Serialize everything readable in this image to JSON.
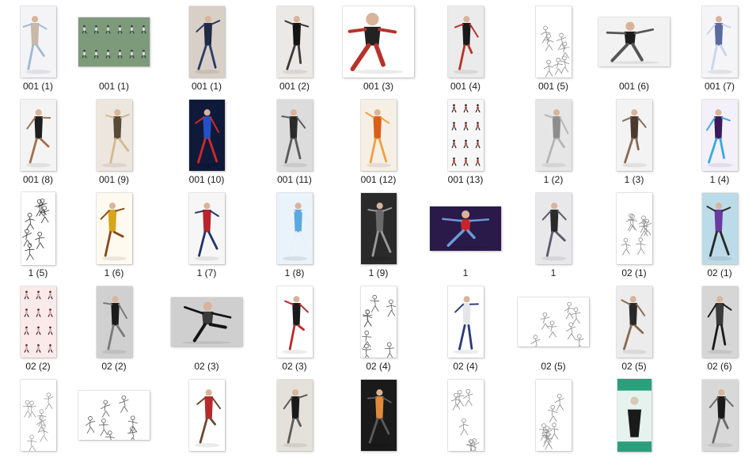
{
  "rows": [
    [
      {
        "label": "001 (1)",
        "shape": "portrait",
        "style": "figure",
        "bg": "#f4f4f6",
        "fg": "#c7b8a8",
        "accent": "#9fb8d8",
        "icon": "image-thumbnail-icon"
      },
      {
        "label": "001 (1)",
        "shape": "landscape",
        "style": "sheet",
        "bg": "#7d9a7b",
        "fg": "#3a3a3a",
        "accent": "#e8e8e8",
        "icon": "image-thumbnail-icon"
      },
      {
        "label": "001 (1)",
        "shape": "portrait",
        "style": "figure",
        "bg": "#d8cfc6",
        "fg": "#1f2a44",
        "accent": "#2c3a66",
        "icon": "image-thumbnail-icon"
      },
      {
        "label": "001 (2)",
        "shape": "portrait",
        "style": "figure",
        "bg": "#ece8e6",
        "fg": "#141414",
        "accent": "#3a3a3a",
        "icon": "image-thumbnail-icon"
      },
      {
        "label": "001 (3)",
        "shape": "square",
        "style": "figure",
        "bg": "#ffffff",
        "fg": "#222222",
        "accent": "#b8322a",
        "icon": "image-thumbnail-icon"
      },
      {
        "label": "001 (4)",
        "shape": "portrait",
        "style": "figure",
        "bg": "#ebebeb",
        "fg": "#1a1a1a",
        "accent": "#b8322a",
        "icon": "image-thumbnail-icon"
      },
      {
        "label": "001 (5)",
        "shape": "portrait",
        "style": "sketch",
        "bg": "#ffffff",
        "fg": "#8a8a8a",
        "accent": "#cfcfcf",
        "icon": "image-thumbnail-icon"
      },
      {
        "label": "001 (6)",
        "shape": "landscape",
        "style": "figure",
        "bg": "#f2f2f2",
        "fg": "#1c1c1c",
        "accent": "#555555",
        "icon": "image-thumbnail-icon"
      },
      {
        "label": "001 (7)",
        "shape": "portrait",
        "style": "figure",
        "bg": "#f5f5f7",
        "fg": "#5b6aa0",
        "accent": "#c9d4ee",
        "icon": "image-thumbnail-icon"
      }
    ],
    [
      {
        "label": "001 (8)",
        "shape": "portrait",
        "style": "figure",
        "bg": "#f4f4f4",
        "fg": "#1e1e1e",
        "accent": "#a07050",
        "icon": "image-thumbnail-icon"
      },
      {
        "label": "001 (9)",
        "shape": "portrait",
        "style": "figure",
        "bg": "#ece6df",
        "fg": "#5a4a3a",
        "accent": "#d8b88a",
        "icon": "image-thumbnail-icon"
      },
      {
        "label": "001 (10)",
        "shape": "portrait",
        "style": "figure",
        "bg": "#0f1a3a",
        "fg": "#2451c8",
        "accent": "#d02a2a",
        "icon": "image-thumbnail-icon"
      },
      {
        "label": "001 (11)",
        "shape": "portrait",
        "style": "figure",
        "bg": "#dcdcdc",
        "fg": "#2a2a2a",
        "accent": "#5a5a5a",
        "icon": "image-thumbnail-icon"
      },
      {
        "label": "001 (12)",
        "shape": "portrait",
        "style": "figure",
        "bg": "#f6efe6",
        "fg": "#d8601a",
        "accent": "#f0a040",
        "icon": "image-thumbnail-icon"
      },
      {
        "label": "001 (13)",
        "shape": "portrait",
        "style": "sheet",
        "bg": "#f7f7f7",
        "fg": "#242424",
        "accent": "#a83a2a",
        "icon": "image-thumbnail-icon"
      },
      {
        "label": "1 (2)",
        "shape": "portrait",
        "style": "figure",
        "bg": "#e6e6e6",
        "fg": "#8d8d8d",
        "accent": "#b5b5b5",
        "icon": "image-thumbnail-icon"
      },
      {
        "label": "1 (3)",
        "shape": "portrait",
        "style": "figure",
        "bg": "#f3f3f3",
        "fg": "#4a3a30",
        "accent": "#8a6a55",
        "icon": "image-thumbnail-icon"
      },
      {
        "label": "1 (4)",
        "shape": "portrait",
        "style": "figure",
        "bg": "#f4f0fa",
        "fg": "#3a1a5a",
        "accent": "#3aa8e0",
        "icon": "image-thumbnail-icon"
      }
    ],
    [
      {
        "label": "1 (5)",
        "shape": "tall",
        "style": "sketch",
        "bg": "#ffffff",
        "fg": "#333333",
        "accent": "#111111",
        "icon": "image-thumbnail-icon"
      },
      {
        "label": "1 (6)",
        "shape": "portrait",
        "style": "figure",
        "bg": "#fffaf0",
        "fg": "#d8a418",
        "accent": "#8a4a1a",
        "icon": "image-thumbnail-icon"
      },
      {
        "label": "1 (7)",
        "shape": "portrait",
        "style": "figure",
        "bg": "#f6f6f6",
        "fg": "#b8242a",
        "accent": "#24346a",
        "icon": "image-thumbnail-icon"
      },
      {
        "label": "1 (8)",
        "shape": "portrait",
        "style": "figure",
        "bg": "#eaf2fa",
        "fg": "#5aa8e0",
        "accent": "#e8f0f8",
        "icon": "image-thumbnail-icon"
      },
      {
        "label": "1 (9)",
        "shape": "portrait",
        "style": "figure",
        "bg": "#2a2a2a",
        "fg": "#6a6a6a",
        "accent": "#9a9a9a",
        "icon": "image-thumbnail-icon"
      },
      {
        "label": "1",
        "shape": "wide",
        "style": "figure",
        "bg": "#2a1a4a",
        "fg": "#c8242a",
        "accent": "#6a9ad8",
        "icon": "image-thumbnail-icon"
      },
      {
        "label": "1",
        "shape": "portrait",
        "style": "figure",
        "bg": "#e8e8ea",
        "fg": "#2a2a2a",
        "accent": "#5a5a6a",
        "icon": "image-thumbnail-icon"
      },
      {
        "label": "02 (1)",
        "shape": "portrait",
        "style": "sketch",
        "bg": "#ffffff",
        "fg": "#8a8a8a",
        "accent": "#cfcfcf",
        "icon": "image-thumbnail-icon"
      },
      {
        "label": "02 (1)",
        "shape": "portrait",
        "style": "figure",
        "bg": "#bcdbe8",
        "fg": "#6a3aa0",
        "accent": "#2a2a2a",
        "icon": "image-thumbnail-icon"
      }
    ],
    [
      {
        "label": "02 (2)",
        "shape": "portrait",
        "style": "sheet",
        "bg": "#fbeaea",
        "fg": "#3a2a2a",
        "accent": "#e89aa0",
        "icon": "image-thumbnail-icon"
      },
      {
        "label": "02 (2)",
        "shape": "portrait",
        "style": "figure",
        "bg": "#d0d0d0",
        "fg": "#1a1a1a",
        "accent": "#7a7a7a",
        "icon": "image-thumbnail-icon"
      },
      {
        "label": "02 (3)",
        "shape": "landscape",
        "style": "figure",
        "bg": "#cfcfcf",
        "fg": "#3a3a3a",
        "accent": "#141414",
        "icon": "image-thumbnail-icon"
      },
      {
        "label": "02 (3)",
        "shape": "portrait",
        "style": "figure",
        "bg": "#ffffff",
        "fg": "#1a1a1a",
        "accent": "#b82a2a",
        "icon": "image-thumbnail-icon"
      },
      {
        "label": "02 (4)",
        "shape": "portrait",
        "style": "sketch",
        "bg": "#ffffff",
        "fg": "#555555",
        "accent": "#aaaaaa",
        "icon": "image-thumbnail-icon"
      },
      {
        "label": "02 (4)",
        "shape": "portrait",
        "style": "figure",
        "bg": "#ffffff",
        "fg": "#e6e6ea",
        "accent": "#2a3a7a",
        "icon": "image-thumbnail-icon"
      },
      {
        "label": "02 (5)",
        "shape": "landscape",
        "style": "sketch",
        "bg": "#ffffff",
        "fg": "#8a8a8a",
        "accent": "#d0d0d0",
        "icon": "image-thumbnail-icon"
      },
      {
        "label": "02 (5)",
        "shape": "portrait",
        "style": "figure",
        "bg": "#ececec",
        "fg": "#2a2a2a",
        "accent": "#8a6a50",
        "icon": "image-thumbnail-icon"
      },
      {
        "label": "02 (6)",
        "shape": "portrait",
        "style": "figure",
        "bg": "#d6d6d6",
        "fg": "#3a3a3a",
        "accent": "#1a1a1a",
        "icon": "image-thumbnail-icon"
      }
    ],
    [
      {
        "label": "",
        "shape": "portrait",
        "style": "sketch",
        "bg": "#ffffff",
        "fg": "#9a9a9a",
        "accent": "#d6d6d6",
        "icon": "image-thumbnail-icon"
      },
      {
        "label": "",
        "shape": "landscape",
        "style": "sketch",
        "bg": "#ffffff",
        "fg": "#555555",
        "accent": "#bdbdbd",
        "icon": "image-thumbnail-icon"
      },
      {
        "label": "",
        "shape": "portrait",
        "style": "figure",
        "bg": "#ffffff",
        "fg": "#b82a2a",
        "accent": "#6a4a30",
        "icon": "image-thumbnail-icon"
      },
      {
        "label": "",
        "shape": "portrait",
        "style": "figure",
        "bg": "#e4e0da",
        "fg": "#1a1a1a",
        "accent": "#5a5a5a",
        "icon": "image-thumbnail-icon"
      },
      {
        "label": "",
        "shape": "portrait",
        "style": "figure",
        "bg": "#1a1a1a",
        "fg": "#e08a3a",
        "accent": "#5a5a5a",
        "icon": "image-thumbnail-icon"
      },
      {
        "label": "",
        "shape": "portrait",
        "style": "sketch",
        "bg": "#ffffff",
        "fg": "#8a8a8a",
        "accent": "#cfcfcf",
        "icon": "image-thumbnail-icon"
      },
      {
        "label": "",
        "shape": "portrait",
        "style": "sketch",
        "bg": "#ffffff",
        "fg": "#8a8a8a",
        "accent": "#cfcfcf",
        "icon": "image-thumbnail-icon"
      },
      {
        "label": "",
        "shape": "tall",
        "style": "poster",
        "bg": "#e6f2ee",
        "fg": "#2aa07a",
        "accent": "#1a1a1a",
        "icon": "image-thumbnail-icon"
      },
      {
        "label": "",
        "shape": "portrait",
        "style": "figure",
        "bg": "#d8d8d8",
        "fg": "#1a1a1a",
        "accent": "#6a6a6a",
        "icon": "image-thumbnail-icon"
      }
    ]
  ]
}
